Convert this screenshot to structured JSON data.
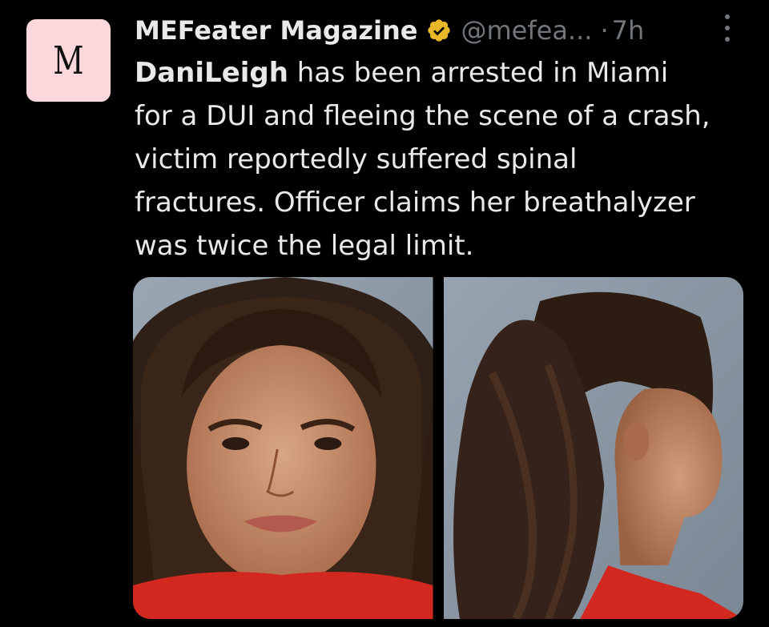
{
  "tweet": {
    "avatar_letter": "M",
    "display_name": "MEFeater Magazine",
    "handle": "@mefea...",
    "separator": "·",
    "time": "7h",
    "text_lines": [
      {
        "bold": "DaniLeigh",
        "rest": " has been arrested in Miami"
      },
      {
        "bold": "",
        "rest": "for a DUI and fleeing the scene of a crash,"
      },
      {
        "bold": "",
        "rest": "victim reportedly suffered spinal"
      },
      {
        "bold": "",
        "rest": "fractures. Officer claims her breathalyzer"
      },
      {
        "bold": "",
        "rest": "was twice the legal limit."
      }
    ]
  },
  "icons": {
    "verified": "verified-badge-icon",
    "more": "more-options-icon"
  },
  "colors": {
    "background": "#000000",
    "text": "#e7e9ea",
    "secondary": "#71767b",
    "verified_gold": "#e8b829",
    "avatar_bg": "#fcd7dc"
  }
}
